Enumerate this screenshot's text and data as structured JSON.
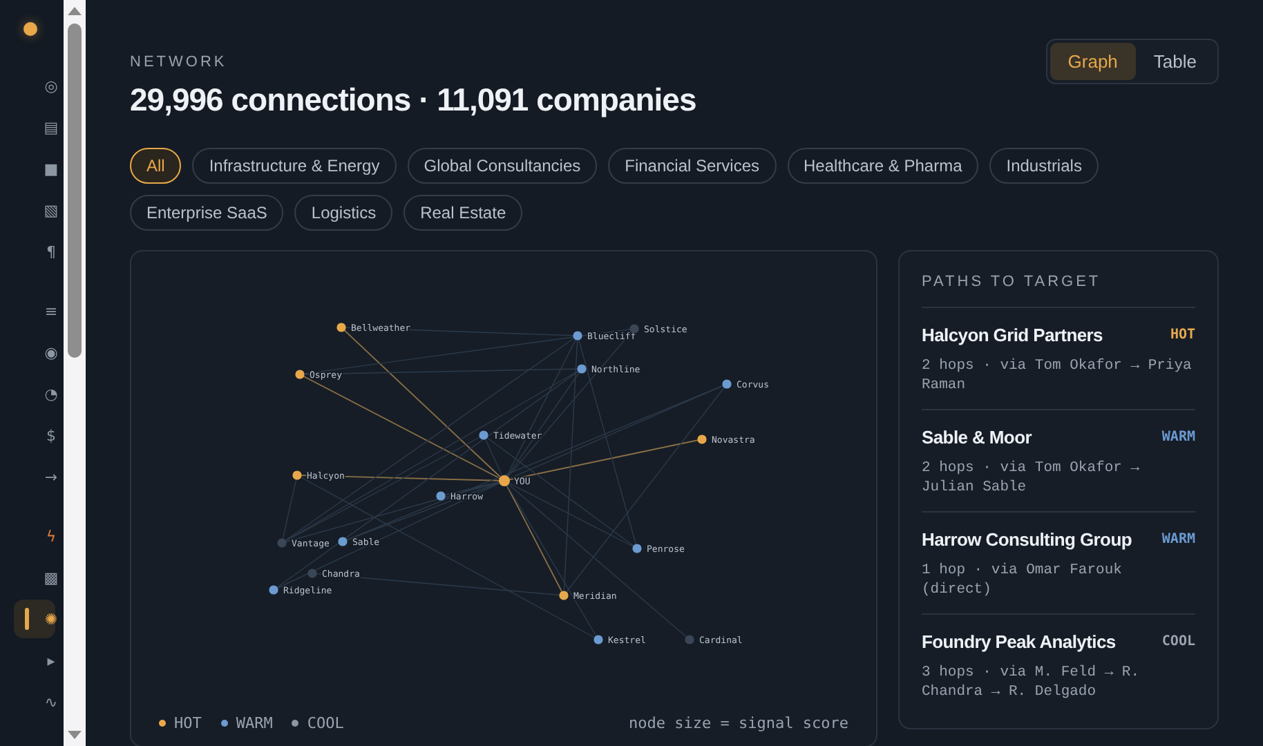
{
  "sidebar": {
    "groups": [
      [
        {
          "glyph": "◎",
          "selected": false,
          "accent": false
        },
        {
          "glyph": "▤",
          "selected": false,
          "accent": false
        },
        {
          "glyph": "■",
          "selected": false,
          "accent": false
        },
        {
          "glyph": "▧",
          "selected": false,
          "accent": false
        },
        {
          "glyph": "¶",
          "selected": false,
          "accent": false
        }
      ],
      [
        {
          "glyph": "≡",
          "selected": false,
          "accent": false
        },
        {
          "glyph": "◉",
          "selected": false,
          "accent": false
        },
        {
          "glyph": "◔",
          "selected": false,
          "accent": false
        },
        {
          "glyph": "$",
          "selected": false,
          "accent": false
        },
        {
          "glyph": "→",
          "selected": false,
          "accent": false
        }
      ],
      [
        {
          "glyph": "ϟ",
          "selected": false,
          "accent": true
        },
        {
          "glyph": "▩",
          "selected": false,
          "accent": false
        },
        {
          "glyph": "✺",
          "selected": true,
          "accent": false
        },
        {
          "glyph": "▸",
          "selected": false,
          "accent": false
        },
        {
          "glyph": "∿",
          "selected": false,
          "accent": false
        }
      ]
    ]
  },
  "header": {
    "eyebrow": "NETWORK",
    "title": "29,996 connections · 11,091 companies"
  },
  "view_toggle": [
    {
      "label": "Graph",
      "selected": true
    },
    {
      "label": "Table",
      "selected": false
    }
  ],
  "filters": [
    {
      "label": "All",
      "selected": true
    },
    {
      "label": "Infrastructure & Energy",
      "selected": false
    },
    {
      "label": "Global Consultancies",
      "selected": false
    },
    {
      "label": "Financial Services",
      "selected": false
    },
    {
      "label": "Healthcare & Pharma",
      "selected": false
    },
    {
      "label": "Industrials",
      "selected": false
    },
    {
      "label": "Enterprise SaaS",
      "selected": false
    },
    {
      "label": "Logistics",
      "selected": false
    },
    {
      "label": "Real Estate",
      "selected": false
    }
  ],
  "graph": {
    "nodes": [
      {
        "label": "Bellweather",
        "color": "#e8a84a"
      },
      {
        "label": "Osprey",
        "color": "#e8a84a"
      },
      {
        "label": "Bluecliff",
        "color": "#6b9bd1"
      },
      {
        "label": "Solstice",
        "color": "#3a4556"
      },
      {
        "label": "Northline",
        "color": "#6b9bd1"
      },
      {
        "label": "Corvus",
        "color": "#6b9bd1"
      },
      {
        "label": "Tidewater",
        "color": "#6b9bd1"
      },
      {
        "label": "Novastra",
        "color": "#e8a84a"
      },
      {
        "label": "Halcyon",
        "color": "#e8a84a"
      },
      {
        "label": "YOU",
        "color": "#e8a84a"
      },
      {
        "label": "Harrow",
        "color": "#6b9bd1"
      },
      {
        "label": "Penrose",
        "color": "#6b9bd1"
      },
      {
        "label": "Vantage",
        "color": "#3a4556"
      },
      {
        "label": "Sable",
        "color": "#6b9bd1"
      },
      {
        "label": "Chandra",
        "color": "#3a4556"
      },
      {
        "label": "Ridgeline",
        "color": "#6b9bd1"
      },
      {
        "label": "Meridian",
        "color": "#e8a84a"
      },
      {
        "label": "Kestrel",
        "color": "#6b9bd1"
      },
      {
        "label": "Cardinal",
        "color": "#3a4556"
      }
    ],
    "legend": [
      {
        "label": "HOT",
        "color": "#e8a84a"
      },
      {
        "label": "WARM",
        "color": "#6b9bd1"
      },
      {
        "label": "COOL",
        "color": "#8d96a3"
      }
    ],
    "note": "node size = signal score"
  },
  "paths": {
    "title": "PATHS TO TARGET",
    "items": [
      {
        "company": "Halcyon Grid Partners",
        "tag": "HOT",
        "color": "#e8a84a",
        "route": "2 hops · via Tom Okafor → Priya Raman"
      },
      {
        "company": "Sable & Moor",
        "tag": "WARM",
        "color": "#6b9bd1",
        "route": "2 hops · via Tom Okafor → Julian Sable"
      },
      {
        "company": "Harrow Consulting Group",
        "tag": "WARM",
        "color": "#6b9bd1",
        "route": "1 hop · via Omar Farouk (direct)"
      },
      {
        "company": "Foundry Peak Analytics",
        "tag": "COOL",
        "color": "#9aa3af",
        "route": "3 hops · via M. Feld → R. Chandra → R. Delgado"
      }
    ]
  }
}
